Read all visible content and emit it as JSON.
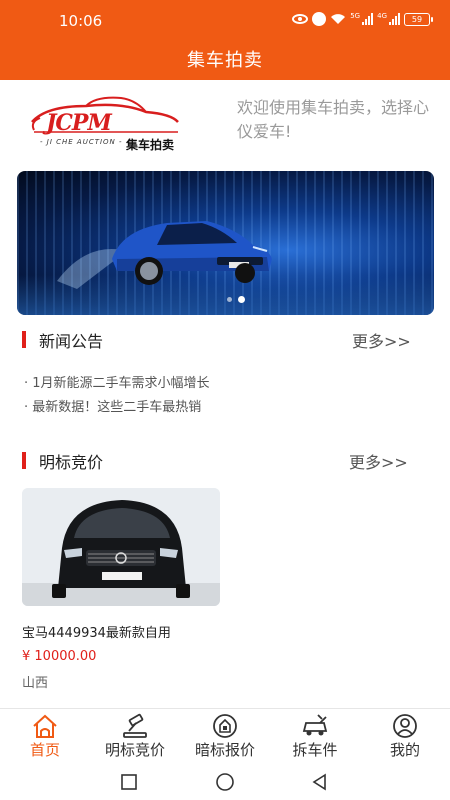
{
  "status": {
    "time": "10:06",
    "battery": "59",
    "net1": "5G",
    "net2": "4G"
  },
  "app": {
    "title": "集车拍卖"
  },
  "logo": {
    "brand": "JCPM",
    "sub": "- JI CHE AUCTION -",
    "cn": "集车拍卖"
  },
  "welcome": "欢迎使用集车拍卖，选择心仪爱车!",
  "banner": {
    "pages": 2,
    "active_index": 1
  },
  "news": {
    "title": "新闻公告",
    "more": "更多>>",
    "items": [
      "· 1月新能源二手车需求小幅增长",
      "· 最新数据！这些二手车最热销"
    ]
  },
  "auction": {
    "title": "明标竞价",
    "more": "更多>>",
    "items": [
      {
        "name": "宝马4449934最新款自用",
        "price": "¥ 10000.00",
        "location": "山西"
      }
    ]
  },
  "tabs": [
    {
      "label": "首页",
      "icon": "home-icon",
      "active": true
    },
    {
      "label": "明标竞价",
      "icon": "gavel-icon",
      "active": false
    },
    {
      "label": "暗标报价",
      "icon": "sealed-bid-icon",
      "active": false
    },
    {
      "label": "拆车件",
      "icon": "car-parts-icon",
      "active": false
    },
    {
      "label": "我的",
      "icon": "user-icon",
      "active": false
    }
  ],
  "colors": {
    "accent": "#f05a14",
    "price": "#e0201a",
    "section_bar": "#e0201a"
  }
}
